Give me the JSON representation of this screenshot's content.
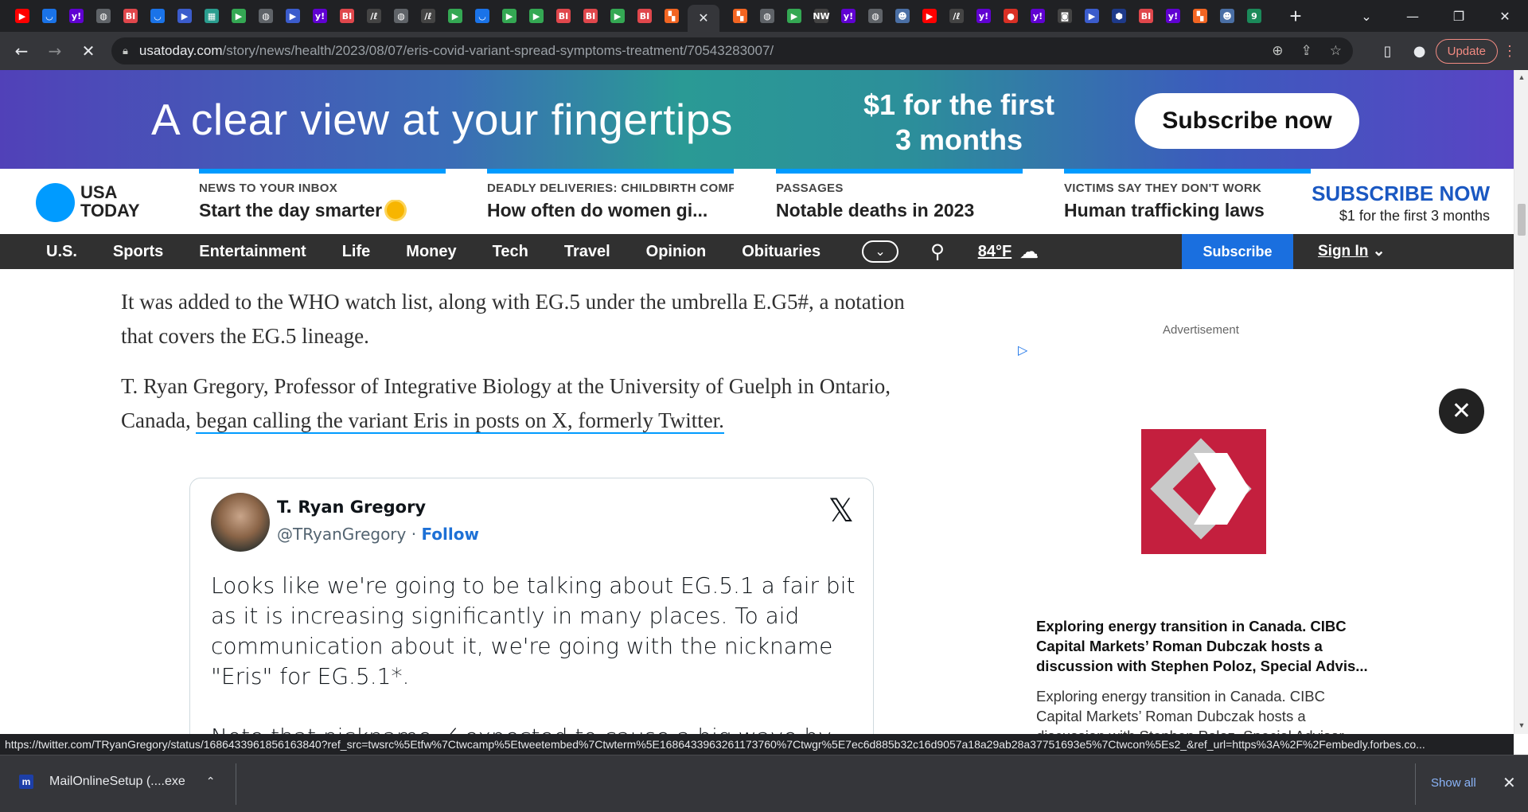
{
  "browser": {
    "tabs": [
      {
        "icon": "youtube-icon",
        "glyph": "▶",
        "bg": "#ff0000"
      },
      {
        "icon": "shield-icon",
        "glyph": "◡",
        "bg": "#1a73e8"
      },
      {
        "icon": "yahoo-icon",
        "glyph": "y!",
        "bg": "#6001d2"
      },
      {
        "icon": "globe-icon",
        "glyph": "◍",
        "bg": "#5f6368"
      },
      {
        "icon": "business-insider-icon",
        "glyph": "BI",
        "bg": "#e0474c"
      },
      {
        "icon": "shield-icon",
        "glyph": "◡",
        "bg": "#1a73e8"
      },
      {
        "icon": "flag-icon",
        "glyph": "▶",
        "bg": "#3b5ccc"
      },
      {
        "icon": "tile-icon",
        "glyph": "▦",
        "bg": "#2a9d8f"
      },
      {
        "icon": "play-icon",
        "glyph": "▶",
        "bg": "#34a853"
      },
      {
        "icon": "globe-icon",
        "glyph": "◍",
        "bg": "#5f6368"
      },
      {
        "icon": "flag-icon",
        "glyph": "▶",
        "bg": "#3b5ccc"
      },
      {
        "icon": "yahoo-icon",
        "glyph": "y!",
        "bg": "#6001d2"
      },
      {
        "icon": "business-insider-icon",
        "glyph": "BI",
        "bg": "#e0474c"
      },
      {
        "icon": "news-icon",
        "glyph": "/ℓ",
        "bg": "#444"
      },
      {
        "icon": "globe-icon",
        "glyph": "◍",
        "bg": "#5f6368"
      },
      {
        "icon": "news-icon",
        "glyph": "/ℓ",
        "bg": "#444"
      },
      {
        "icon": "play-icon",
        "glyph": "▶",
        "bg": "#34a853"
      },
      {
        "icon": "shield-icon",
        "glyph": "◡",
        "bg": "#1a73e8"
      },
      {
        "icon": "play-icon",
        "glyph": "▶",
        "bg": "#34a853"
      },
      {
        "icon": "play-icon",
        "glyph": "▶",
        "bg": "#34a853"
      },
      {
        "icon": "business-insider-icon",
        "glyph": "BI",
        "bg": "#e0474c"
      },
      {
        "icon": "business-insider-icon",
        "glyph": "BI",
        "bg": "#e0474c"
      },
      {
        "icon": "play-icon",
        "glyph": "▶",
        "bg": "#34a853"
      },
      {
        "icon": "business-insider-icon",
        "glyph": "BI",
        "bg": "#e0474c"
      },
      {
        "icon": "bookmark-icon",
        "glyph": "▚",
        "bg": "#f26522"
      }
    ],
    "active_tab": {
      "close": "✕"
    },
    "tabs_after": [
      {
        "icon": "bookmark-icon",
        "glyph": "▚",
        "bg": "#f26522"
      },
      {
        "icon": "globe-icon",
        "glyph": "◍",
        "bg": "#5f6368"
      },
      {
        "icon": "play-icon",
        "glyph": "▶",
        "bg": "#34a853"
      },
      {
        "icon": "news-icon",
        "glyph": "NW",
        "bg": "#444"
      },
      {
        "icon": "yahoo-icon",
        "glyph": "y!",
        "bg": "#6001d2"
      },
      {
        "icon": "globe-icon",
        "glyph": "◍",
        "bg": "#5f6368"
      },
      {
        "icon": "person-icon",
        "glyph": "☻",
        "bg": "#4a6fa5"
      },
      {
        "icon": "youtube-icon",
        "glyph": "▶",
        "bg": "#ff0000"
      },
      {
        "icon": "news-icon",
        "glyph": "/ℓ",
        "bg": "#444"
      },
      {
        "icon": "yahoo-icon",
        "glyph": "y!",
        "bg": "#6001d2"
      },
      {
        "icon": "pin-icon",
        "glyph": "●",
        "bg": "#d93025"
      },
      {
        "icon": "yahoo-icon",
        "glyph": "y!",
        "bg": "#6001d2"
      },
      {
        "icon": "news-icon",
        "glyph": "◙",
        "bg": "#444"
      },
      {
        "icon": "flag-icon",
        "glyph": "▶",
        "bg": "#3b5ccc"
      },
      {
        "icon": "hexagon-icon",
        "glyph": "⬢",
        "bg": "#1e3a8a"
      },
      {
        "icon": "business-insider-icon",
        "glyph": "BI",
        "bg": "#e0474c"
      },
      {
        "icon": "yahoo-icon",
        "glyph": "y!",
        "bg": "#6001d2"
      },
      {
        "icon": "bookmark-icon",
        "glyph": "▚",
        "bg": "#f26522"
      },
      {
        "icon": "person-icon",
        "glyph": "☻",
        "bg": "#4a6fa5"
      },
      {
        "icon": "nine-icon",
        "glyph": "9",
        "bg": "#1b8a5a"
      }
    ],
    "new_tab": "+",
    "window_controls": {
      "list": "⌄",
      "minimize": "—",
      "restore": "❐",
      "close": "✕"
    },
    "back": "←",
    "forward": "→",
    "stop": "✕",
    "url_host": "usatoday.com",
    "url_path": "/story/news/health/2023/08/07/eris-covid-variant-spread-symptoms-treatment/70543283007/",
    "omnibox_icons": {
      "zoom": "⊕",
      "share": "⇪",
      "star": "☆"
    },
    "sidepanel": "▯",
    "profile": "●",
    "update_label": "Update",
    "menu": "⋮"
  },
  "banner": {
    "headline": "A clear view at your fingertips",
    "offer_line1": "$1 for the first",
    "offer_line2": "3 months",
    "cta": "Subscribe now"
  },
  "header": {
    "logo_line1": "USA",
    "logo_line2": "TODAY",
    "promos": [
      {
        "kicker": "NEWS TO YOUR INBOX",
        "headline": "Start the day smarter"
      },
      {
        "kicker": "DEADLY DELIVERIES: CHILDBIRTH COMP",
        "headline": "How often do women gi..."
      },
      {
        "kicker": "PASSAGES",
        "headline": "Notable deaths in 2023"
      },
      {
        "kicker": "VICTIMS SAY THEY DON'T WORK",
        "headline": "Human trafficking laws"
      }
    ],
    "subscribe_title": "SUBSCRIBE NOW",
    "subscribe_sub": "$1 for the first 3 months"
  },
  "nav": {
    "items": [
      "U.S.",
      "Sports",
      "Entertainment",
      "Life",
      "Money",
      "Tech",
      "Travel",
      "Opinion",
      "Obituaries"
    ],
    "more": "⌄",
    "search": "⚲",
    "temperature": "84°F",
    "weather": "☁",
    "subscribe": "Subscribe",
    "signin": "Sign In",
    "signin_chevron": "⌄"
  },
  "article": {
    "p1": "It was added to the WHO watch list, along with EG.5 under the umbrella E.G5#, a notation that covers the EG.5 lineage.",
    "p2_start": "T. Ryan Gregory, Professor of Integrative Biology at the University of Guelph in Ontario, Canada, ",
    "p2_link": "began calling the variant Eris in posts on X, formerly Twitter."
  },
  "tweet": {
    "name": "T. Ryan Gregory",
    "handle": "@TRyanGregory",
    "sep": " · ",
    "follow": "Follow",
    "x_logo": "𝕏",
    "text": "Looks like we're going to be talking about EG.5.1 a fair bit as it is increasing significantly in many places. To aid communication about it, we're going with the nickname \"Eris\" for EG.5.1*.",
    "text2": "Note that nickname ≠ expected to cause a big wave by"
  },
  "ad": {
    "label": "Advertisement",
    "adchoices": "▷",
    "close": "✕",
    "title": "Exploring energy transition in Canada. CIBC Capital Markets’ Roman Dubczak hosts a discussion with Stephen Poloz, Special Advis...",
    "desc": "Exploring energy transition in Canada. CIBC Capital Markets’ Roman Dubczak hosts a discussion with Stephen Poloz, Special Advisor"
  },
  "status_url": "https://twitter.com/TRyanGregory/status/1686433961856163840?ref_src=twsrc%5Etfw%7Ctwcamp%5Etweetembed%7Ctwterm%5E1686433963261173760%7Ctwgr%5E7ec6d885b32c16d9057a18a29ab28a37751693e5%7Ctwcon%5Es2_&ref_url=https%3A%2F%2Fembedly.forbes.co...",
  "downloads": {
    "file_icon": "m",
    "file": "MailOnlineSetup (....exe",
    "chevron": "⌃",
    "show_all": "Show all",
    "close": "✕"
  }
}
